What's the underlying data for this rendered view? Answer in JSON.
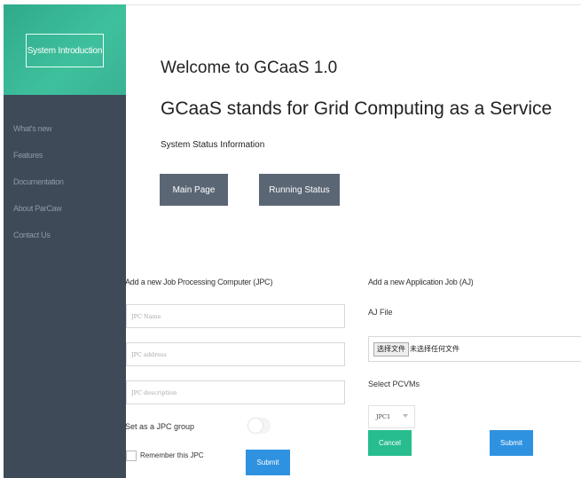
{
  "sidebar": {
    "intro_button": "System Introduction",
    "items": [
      {
        "label": "What's new"
      },
      {
        "label": "Features"
      },
      {
        "label": "Documentation"
      },
      {
        "label": "About ParCaw"
      },
      {
        "label": "Contact Us"
      }
    ]
  },
  "header": {
    "title": "Welcome to GCaaS 1.0",
    "subtitle": "GCaaS stands for Grid Computing as a Service",
    "status_label": "System Status Information",
    "main_page_button": "Main Page",
    "running_status_button": "Running Status"
  },
  "jpc_form": {
    "title": "Add a new Job Processing Computer (JPC)",
    "name_placeholder": "JPC Name",
    "address_placeholder": "JPC address",
    "description_placeholder": "JPC description",
    "group_label": "Set as a JPC group",
    "group_enabled": false,
    "remember_label": "Remember this JPC",
    "remember_checked": false,
    "submit_label": "Submit"
  },
  "aj_form": {
    "title": "Add a new Application Job (AJ)",
    "file_label": "AJ File",
    "file_button": "选择文件",
    "file_status": "未选择任何文件",
    "pcvm_label": "Select PCVMs",
    "pcvm_selected": "JPC1",
    "cancel_label": "Cancel",
    "submit_label": "Submit"
  },
  "colors": {
    "sidebar": "#3e4a58",
    "sidebar_top": "#3fc09d",
    "dark_button": "#5b6675",
    "submit_blue": "#2f92e0",
    "cancel_green": "#27bd8f"
  }
}
